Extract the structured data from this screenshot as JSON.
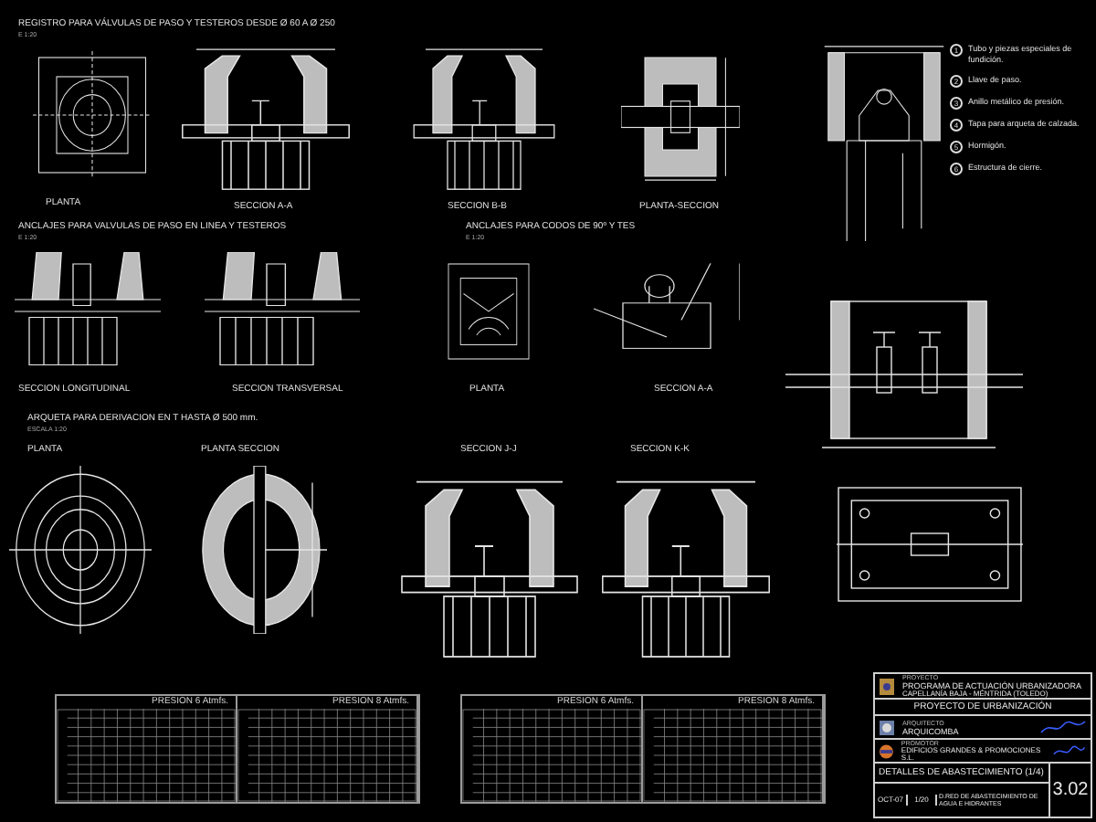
{
  "sections": [
    {
      "title": "REGISTRO PARA VÁLVULAS DE PASO Y TESTEROS  DESDE Ø 60 A Ø 250",
      "scale": "E 1:20",
      "views": [
        {
          "label": "PLANTA",
          "kind": "square-plan"
        },
        {
          "label": "SECCION A-A",
          "kind": "chamber-section"
        },
        {
          "label": "SECCION B-B",
          "kind": "chamber-section"
        },
        {
          "label": "PLANTA-SECCION",
          "kind": "square-section"
        }
      ]
    },
    {
      "title": "ANCLAJES PARA VALVULAS DE PASO  EN LINEA Y TESTEROS",
      "scale": "E 1:20",
      "views": [
        {
          "label": "SECCION LONGITUDINAL",
          "kind": "anchor-section"
        },
        {
          "label": "SECCION TRANSVERSAL",
          "kind": "anchor-section"
        }
      ]
    },
    {
      "title": "ANCLAJES PARA CODOS DE 90º Y TES",
      "scale": "E 1:20",
      "views": [
        {
          "label": "PLANTA",
          "kind": "elbow-plan"
        },
        {
          "label": "SECCION A-A",
          "kind": "anchor-tee"
        }
      ]
    },
    {
      "title": "ARQUETA PARA DERIVACION EN T HASTA  Ø 500 mm.",
      "scale": "ESCALA 1:20",
      "views": [
        {
          "label": "PLANTA",
          "kind": "circle-plan"
        },
        {
          "label": "PLANTA SECCION",
          "kind": "ring-section"
        },
        {
          "label": "SECCION J-J",
          "kind": "chamber-section"
        },
        {
          "label": "SECCION K-K",
          "kind": "chamber-section"
        }
      ]
    }
  ],
  "detail": {
    "notes": [
      {
        "number": "1",
        "text": "Tubo y piezas especiales de fundición."
      },
      {
        "number": "2",
        "text": "Llave de paso."
      },
      {
        "number": "3",
        "text": "Anillo metálico de presión."
      },
      {
        "number": "4",
        "text": "Tapa para arqueta de calzada."
      },
      {
        "number": "5",
        "text": "Hormigón."
      },
      {
        "number": "6",
        "text": "Estructura de cierre."
      }
    ]
  },
  "tables": [
    {
      "halves": [
        "PRESION 6 Atmfs.",
        "PRESION 8 Atmfs."
      ]
    },
    {
      "halves": [
        "PRESION 6 Atmfs.",
        "PRESION 8 Atmfs."
      ]
    }
  ],
  "title_block": {
    "project_label": "PROYECTO",
    "project": "PROGRAMA DE ACTUACIÓN URBANIZADORA",
    "location": "CAPELLANÍA BAJA - MÉNTRIDA (TOLEDO)",
    "subtitle": "PROYECTO DE URBANIZACIÓN",
    "architect_label": "ARQUITECTO",
    "architect": "ARQUICOMBA",
    "promoter_label": "PROMOTOR",
    "promoter": "EDIFICIOS GRANDES & PROMOCIONES S.L.",
    "sheet_title": "DETALLES DE ABASTECIMIENTO (1/4)",
    "date": "OCT-07",
    "scale": "1/20",
    "description": "D.RED DE ABASTECIMIENTO DE AGUA E HIDRANTES",
    "sheet_number": "3.02"
  }
}
